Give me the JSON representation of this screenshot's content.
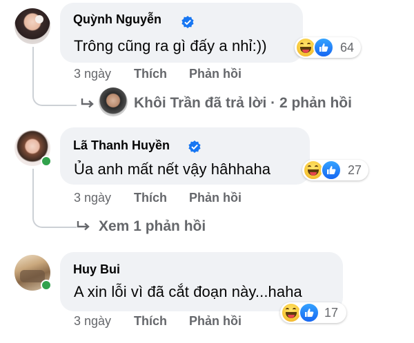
{
  "comments": [
    {
      "author": "Quỳnh Nguyễn",
      "verified": true,
      "text": "Trông cũng ra gì đấy a nhỉ:))",
      "reaction_count": "64",
      "time": "3 ngày",
      "like_label": "Thích",
      "reply_label": "Phản hồi",
      "reply_summary": "Khôi Trần đã trả lời · 2 phản hồi"
    },
    {
      "author": "Lã Thanh Huyền",
      "verified": true,
      "text": "Ủa anh mất nết vậy hâhhaha",
      "reaction_count": "27",
      "time": "3 ngày",
      "like_label": "Thích",
      "reply_label": "Phản hồi",
      "reply_summary": "Xem 1 phản hồi"
    },
    {
      "author": "Huy Bui",
      "verified": false,
      "text": "A xin lỗi vì đã cắt đoạn này...haha",
      "reaction_count": "17",
      "time": "3 ngày",
      "like_label": "Thích",
      "reply_label": "Phản hồi"
    }
  ],
  "icons": {
    "reaction_haha": "haha-icon",
    "reaction_like": "like-icon",
    "verified": "verified-badge-icon",
    "reply_arrow": "reply-arrow-icon"
  },
  "colors": {
    "bubble": "#f0f2f5",
    "secondary_text": "#65676b",
    "verified_blue": "#1877f2",
    "online_green": "#31a24c"
  }
}
